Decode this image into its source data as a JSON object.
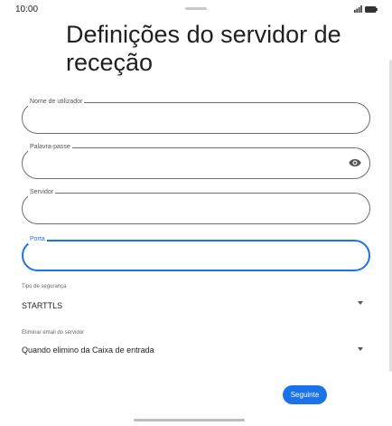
{
  "status_bar": {
    "time": "10:00"
  },
  "page": {
    "title": "Definições do servidor de receção"
  },
  "fields": {
    "username": {
      "label": "Nome de utilizador",
      "value": ""
    },
    "password": {
      "label": "Palavra-passe",
      "value": ""
    },
    "server": {
      "label": "Servidor",
      "value": ""
    },
    "port": {
      "label": "Porta",
      "value": ""
    }
  },
  "selects": {
    "security": {
      "label": "Tipo de segurança",
      "value": "STARTTLS"
    },
    "delete_email": {
      "label": "Eliminar email do servidor",
      "value": "Quando elimino da Caixa de entrada"
    }
  },
  "actions": {
    "next_label": "Seguinte"
  },
  "colors": {
    "accent": "#1a73e8",
    "outline": "#6d6d6d"
  },
  "icons": [
    "signal-icon",
    "battery-icon",
    "eye-icon",
    "dropdown-arrow-icon"
  ]
}
